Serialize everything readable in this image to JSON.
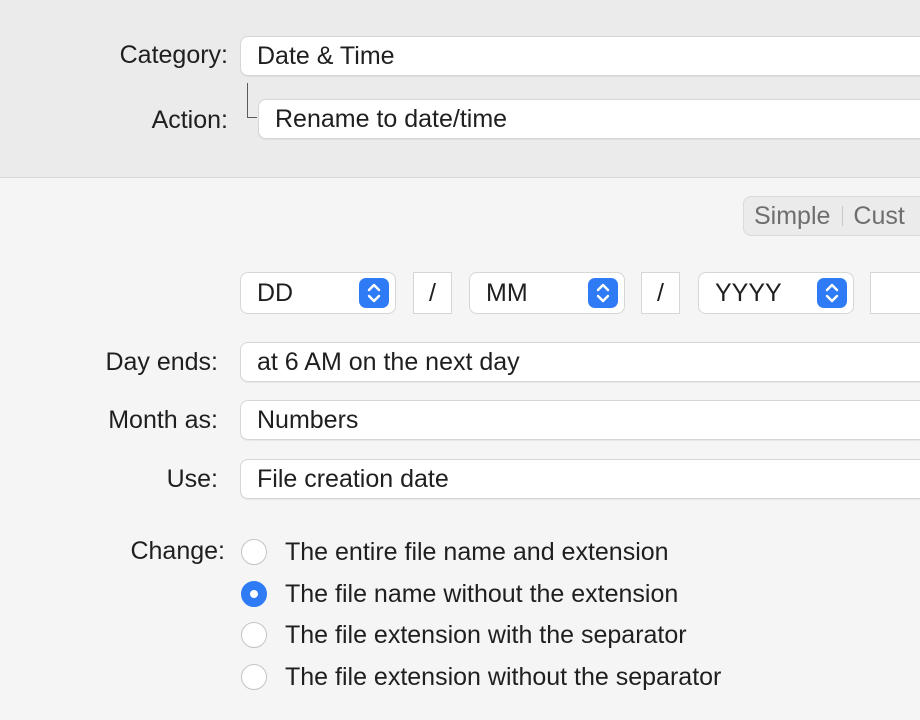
{
  "header": {
    "category_label": "Category:",
    "category_value": "Date & Time",
    "action_label": "Action:",
    "action_value": "Rename to date/time"
  },
  "mode_switch": {
    "simple_label": "Simple",
    "custom_label": "Cust"
  },
  "format": {
    "day_token": "DD",
    "separator_1": "/",
    "month_token": "MM",
    "separator_2": "/",
    "year_token": "YYYY",
    "trailing_field": ""
  },
  "options": {
    "day_ends_label": "Day ends:",
    "day_ends_value": "at 6 AM on the next day",
    "month_as_label": "Month as:",
    "month_as_value": "Numbers",
    "use_label": "Use:",
    "use_value": "File creation date"
  },
  "change": {
    "label": "Change:",
    "choices": [
      {
        "label": "The entire file name and extension",
        "selected": false
      },
      {
        "label": "The file name without the extension",
        "selected": true
      },
      {
        "label": "The file extension with the separator",
        "selected": false
      },
      {
        "label": "The file extension without the separator",
        "selected": false
      }
    ]
  },
  "colors": {
    "accent": "#2f7bf6",
    "panel_top": "#ebebeb",
    "panel_bottom": "#f5f5f5"
  }
}
